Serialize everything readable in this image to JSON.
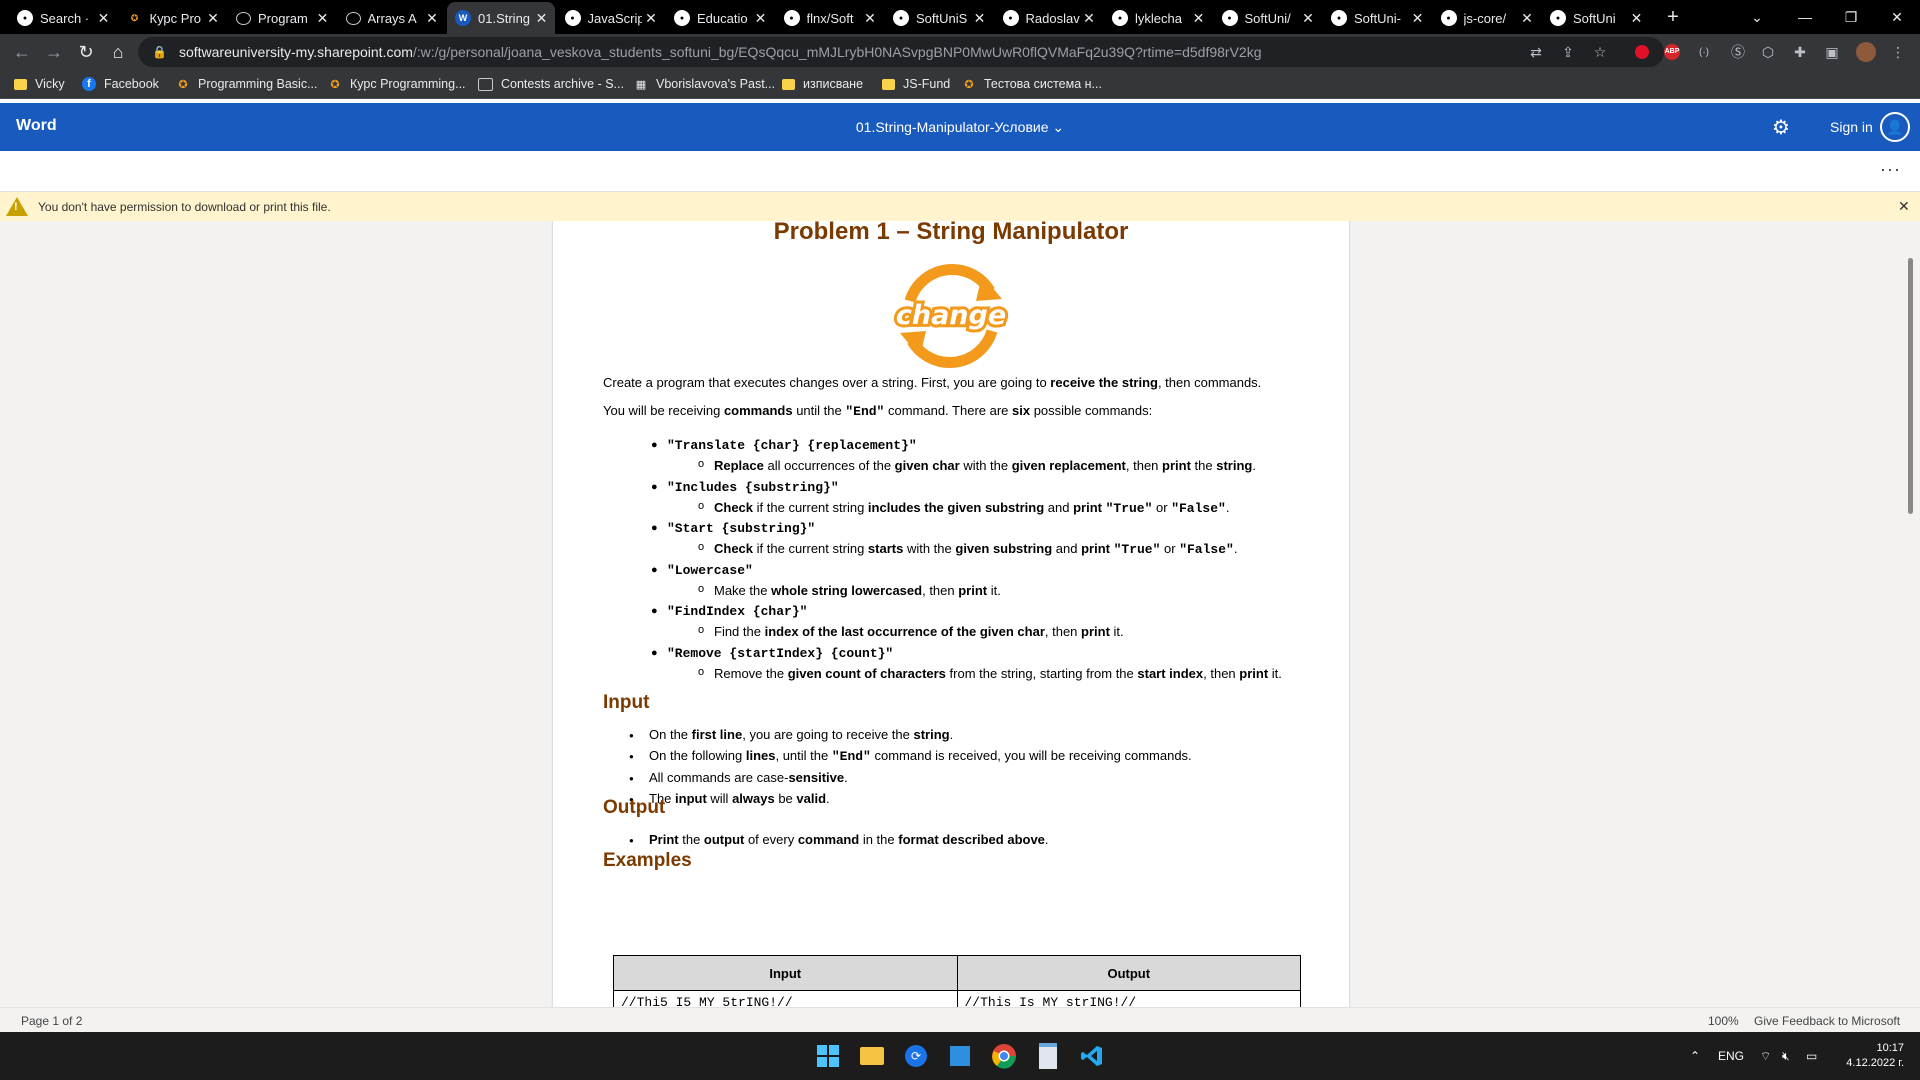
{
  "browser": {
    "tabs": [
      {
        "label": "Search ·",
        "icon": "github-icon",
        "active": false
      },
      {
        "label": "Курс Pro",
        "icon": "softuni-icon",
        "active": false
      },
      {
        "label": "Program",
        "icon": "document-icon",
        "active": false
      },
      {
        "label": "Arrays A",
        "icon": "document-icon",
        "active": false
      },
      {
        "label": "01.String",
        "icon": "word-icon",
        "active": true
      },
      {
        "label": "JavaScrip",
        "icon": "github-icon",
        "active": false
      },
      {
        "label": "Educatio",
        "icon": "github-icon",
        "active": false
      },
      {
        "label": "flnx/Soft",
        "icon": "github-icon",
        "active": false
      },
      {
        "label": "SoftUniS",
        "icon": "github-icon",
        "active": false
      },
      {
        "label": "Radoslav",
        "icon": "github-icon",
        "active": false
      },
      {
        "label": "lyklecha",
        "icon": "github-icon",
        "active": false
      },
      {
        "label": "SoftUni/",
        "icon": "github-icon",
        "active": false
      },
      {
        "label": "SoftUni-",
        "icon": "github-icon",
        "active": false
      },
      {
        "label": "js-core/",
        "icon": "github-icon",
        "active": false
      },
      {
        "label": "SoftUni",
        "icon": "github-icon",
        "active": false
      }
    ],
    "new_tab": "+",
    "url_host": "softwareuniversity-my.sharepoint.com",
    "url_path": "/:w:/g/personal/joana_veskova_students_softuni_bg/EQsQqcu_mMJLrybH0NASvpgBNP0MwUwR0flQVMaFq2u39Q?rtime=d5df98rV2kg",
    "bookmarks": [
      {
        "label": "Vicky",
        "icon": "folder-icon"
      },
      {
        "label": "Facebook",
        "icon": "facebook-icon"
      },
      {
        "label": "Programming Basic...",
        "icon": "softuni-icon"
      },
      {
        "label": "Курс Programming...",
        "icon": "softuni-icon"
      },
      {
        "label": "Contests archive - S...",
        "icon": "document-icon"
      },
      {
        "label": "Vborislavova's Past...",
        "icon": "grid-icon"
      },
      {
        "label": "изписване",
        "icon": "folder-icon"
      },
      {
        "label": "JS-Fund",
        "icon": "folder-icon"
      },
      {
        "label": "Тестова система н...",
        "icon": "softuni-icon"
      }
    ]
  },
  "word": {
    "app_name": "Word",
    "doc_title": "01.String-Manipulator-Условие",
    "signin": "Sign in",
    "more": "···",
    "banner": "You don't have permission to download or print this file."
  },
  "document": {
    "title": "Problem 1 – String Manipulator",
    "logo_text": "change",
    "intro1": {
      "a": "Create a program that executes changes over a string. First, you are going to ",
      "b": "receive the string",
      "c": ", then commands."
    },
    "intro2": {
      "a": "You will be receiving ",
      "b": "commands",
      "c": " until the ",
      "d": "\"End\"",
      "e": " command. There are ",
      "f": "six",
      "g": " possible commands:"
    },
    "commands": [
      {
        "cmd": "\"Translate {char} {replacement}\"",
        "desc": [
          [
            "b",
            "Replace"
          ],
          [
            "n",
            " all occurrences of the "
          ],
          [
            "b",
            "given char"
          ],
          [
            "n",
            " with the "
          ],
          [
            "b",
            "given replacement"
          ],
          [
            "n",
            ", then "
          ],
          [
            "b",
            "print"
          ],
          [
            "n",
            " the "
          ],
          [
            "b",
            "string"
          ],
          [
            "n",
            "."
          ]
        ]
      },
      {
        "cmd": "\"Includes {substring}\"",
        "desc": [
          [
            "b",
            "Check"
          ],
          [
            "n",
            " if the current string "
          ],
          [
            "b",
            "includes the given substring"
          ],
          [
            "n",
            " and "
          ],
          [
            "b",
            "print "
          ],
          [
            "m",
            "\"True\""
          ],
          [
            "n",
            " or "
          ],
          [
            "m",
            "\"False\""
          ],
          [
            "n",
            "."
          ]
        ]
      },
      {
        "cmd": "\"Start {substring}\"",
        "desc": [
          [
            "b",
            "Check"
          ],
          [
            "n",
            " if the current string "
          ],
          [
            "b",
            "starts"
          ],
          [
            "n",
            " with the "
          ],
          [
            "b",
            "given substring"
          ],
          [
            "n",
            " and "
          ],
          [
            "b",
            "print "
          ],
          [
            "m",
            "\"True\""
          ],
          [
            "n",
            " or "
          ],
          [
            "m",
            "\"False\""
          ],
          [
            "n",
            "."
          ]
        ]
      },
      {
        "cmd": "\"Lowercase\"",
        "desc": [
          [
            "n",
            "Make the "
          ],
          [
            "b",
            "whole string lowercased"
          ],
          [
            "n",
            ", then "
          ],
          [
            "b",
            "print"
          ],
          [
            "n",
            " it."
          ]
        ]
      },
      {
        "cmd": "\"FindIndex {char}\"",
        "desc": [
          [
            "n",
            "Find the "
          ],
          [
            "b",
            "index of the last occurrence of the given char"
          ],
          [
            "n",
            ", then "
          ],
          [
            "b",
            "print"
          ],
          [
            "n",
            " it."
          ]
        ]
      },
      {
        "cmd": "\"Remove {startIndex} {count}\"",
        "desc": [
          [
            "n",
            "Remove the "
          ],
          [
            "b",
            "given count of characters"
          ],
          [
            "n",
            " from the string, starting from the "
          ],
          [
            "b",
            "start index"
          ],
          [
            "n",
            ", then "
          ],
          [
            "b",
            "print"
          ],
          [
            "n",
            " it."
          ]
        ]
      }
    ],
    "input_heading": "Input",
    "input_items": [
      [
        [
          "n",
          "On the "
        ],
        [
          "b",
          "first line"
        ],
        [
          "n",
          ", you are going to receive the "
        ],
        [
          "b",
          "string"
        ],
        [
          "n",
          "."
        ]
      ],
      [
        [
          "n",
          "On the following "
        ],
        [
          "b",
          "lines"
        ],
        [
          "n",
          ", until the "
        ],
        [
          "m",
          "\"End\""
        ],
        [
          "n",
          " command is received, you will be receiving commands."
        ]
      ],
      [
        [
          "n",
          "All commands are case-"
        ],
        [
          "b",
          "sensitive"
        ],
        [
          "n",
          "."
        ]
      ],
      [
        [
          "n",
          "The "
        ],
        [
          "b",
          "input"
        ],
        [
          "n",
          " will "
        ],
        [
          "b",
          "always"
        ],
        [
          "n",
          " be "
        ],
        [
          "b",
          "valid"
        ],
        [
          "n",
          "."
        ]
      ]
    ],
    "output_heading": "Output",
    "output_items": [
      [
        [
          "b",
          "Print"
        ],
        [
          "n",
          " the "
        ],
        [
          "b",
          "output"
        ],
        [
          "n",
          " of every "
        ],
        [
          "b",
          "command"
        ],
        [
          "n",
          " in the "
        ],
        [
          "b",
          "format described above"
        ],
        [
          "n",
          "."
        ]
      ]
    ],
    "examples_heading": "Examples",
    "table": {
      "headers": [
        "Input",
        "Output"
      ],
      "row": [
        "//Thi5 I5 MY 5trING!//",
        "//This Is MY strING!//"
      ]
    }
  },
  "status": {
    "page": "Page 1 of 2",
    "zoom": "100%",
    "feedback": "Give Feedback to Microsoft"
  },
  "taskbar": {
    "lang": "ENG",
    "time": "10:17",
    "date": "4.12.2022 г."
  },
  "colors": {
    "word_blue": "#185abd",
    "heading_brown": "#7b3a00",
    "logo_orange": "#f39a1c",
    "banner_yellow": "#fff4ce"
  }
}
